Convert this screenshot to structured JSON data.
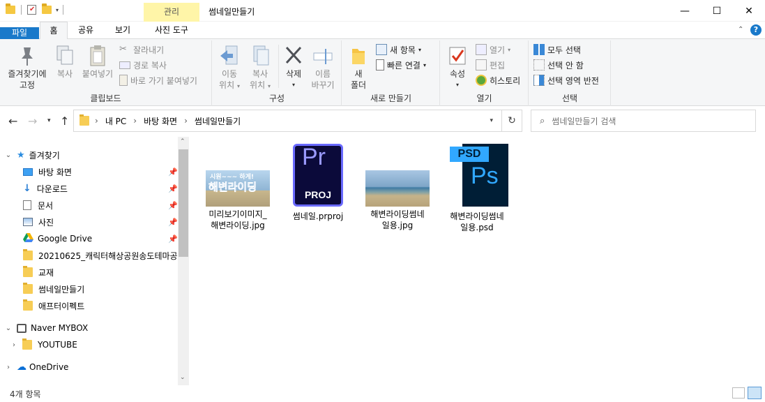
{
  "window": {
    "title": "썸네일만들기",
    "context_tab": "관리",
    "minimize": "—",
    "maximize": "☐",
    "close": "✕"
  },
  "ribbon_tabs": [
    "파일",
    "홈",
    "공유",
    "보기",
    "사진 도구"
  ],
  "ribbon": {
    "clipboard": {
      "pin_label_1": "즐겨찾기에",
      "pin_label_2": "고정",
      "copy": "복사",
      "paste": "붙여넣기",
      "cut": "잘라내기",
      "copy_path": "경로 복사",
      "paste_shortcut": "바로 가기 붙여넣기",
      "group": "클립보드"
    },
    "organize": {
      "move_1": "이동",
      "move_2": "위치",
      "copy_1": "복사",
      "copy_2": "위치",
      "delete": "삭제",
      "rename_1": "이름",
      "rename_2": "바꾸기",
      "group": "구성"
    },
    "new": {
      "new_folder_1": "새",
      "new_folder_2": "폴더",
      "new_item": "새 항목",
      "easy_access": "빠른 연결",
      "group": "새로 만들기"
    },
    "open": {
      "properties": "속성",
      "open": "열기",
      "edit": "편집",
      "history": "히스토리",
      "group": "열기"
    },
    "select": {
      "select_all": "모두 선택",
      "select_none": "선택 안 함",
      "invert": "선택 영역 반전",
      "group": "선택"
    }
  },
  "address": {
    "crumbs": [
      "내 PC",
      "바탕 화면",
      "썸네일만들기"
    ],
    "search_placeholder": "썸네일만들기 검색"
  },
  "nav": {
    "quick_access": "즐겨찾기",
    "items": [
      "바탕 화면",
      "다운로드",
      "문서",
      "사진",
      "Google Drive",
      "20210625_캐릭터해상공원송도테마공",
      "교재",
      "썸네일만들기",
      "애프터이펙트"
    ],
    "mybox": "Naver MYBOX",
    "youtube": "YOUTUBE",
    "onedrive": "OneDrive"
  },
  "files": [
    {
      "line1": "미리보기이미지_",
      "line2": "해변라이딩.jpg",
      "thumb_text_1": "시원~~~ 하게!",
      "thumb_text_2": "해변라이딩"
    },
    {
      "line1": "썸네일.prproj",
      "line2": "",
      "icon_text_1": "Pr",
      "icon_text_2": "PROJ"
    },
    {
      "line1": "해변라이딩썸네",
      "line2": "일용.jpg"
    },
    {
      "line1": "해변라이딩썸네",
      "line2": "일용.psd",
      "icon_text_1": "PSD",
      "icon_text_2": "Ps"
    }
  ],
  "status": {
    "count": "4개 항목"
  },
  "colors": {
    "accent": "#1979ca",
    "manage_tab": "#fff5a8",
    "premiere_bg": "#0b0a3a",
    "premiere_fg": "#9a9aff",
    "photoshop_bg": "#001e36",
    "photoshop_fg": "#31a8ff"
  }
}
